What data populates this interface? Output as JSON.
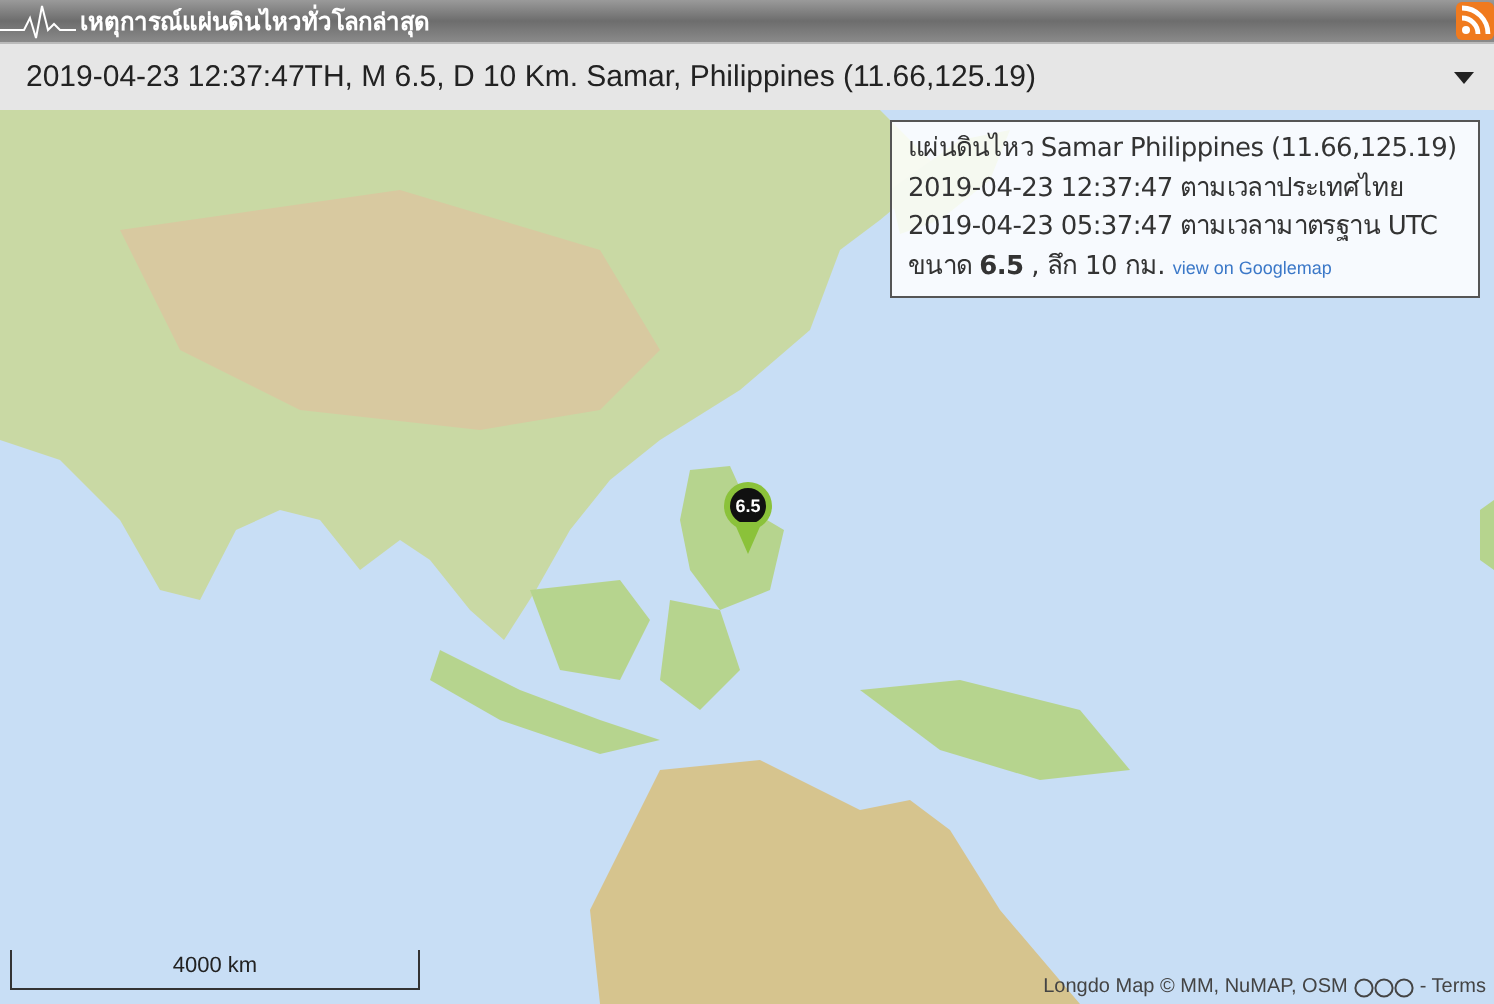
{
  "header": {
    "title": "เหตุการณ์แผ่นดินไหวทั่วโลกล่าสุด"
  },
  "event_select": {
    "value": "2019-04-23 12:37:47TH, M 6.5, D 10 Km. Samar, Philippines (11.66,125.19)"
  },
  "map": {
    "info": {
      "title": "แผ่นดินไหว Samar Philippines (11.66,125.19)",
      "local_time": "2019-04-23 12:37:47 ตามเวลาประเทศไทย",
      "utc_time": "2019-04-23 05:37:47 ตามเวลามาตรฐาน UTC",
      "magnitude_line": "ขนาด **6.5** , ลึก 10 กม.",
      "link": "view on Googlemap"
    },
    "marker": {
      "label": "6.5"
    },
    "scale": "4000 km",
    "attribution": "Longdo Map © MM, NuMAP, OSM",
    "terms_link": "- Terms"
  }
}
